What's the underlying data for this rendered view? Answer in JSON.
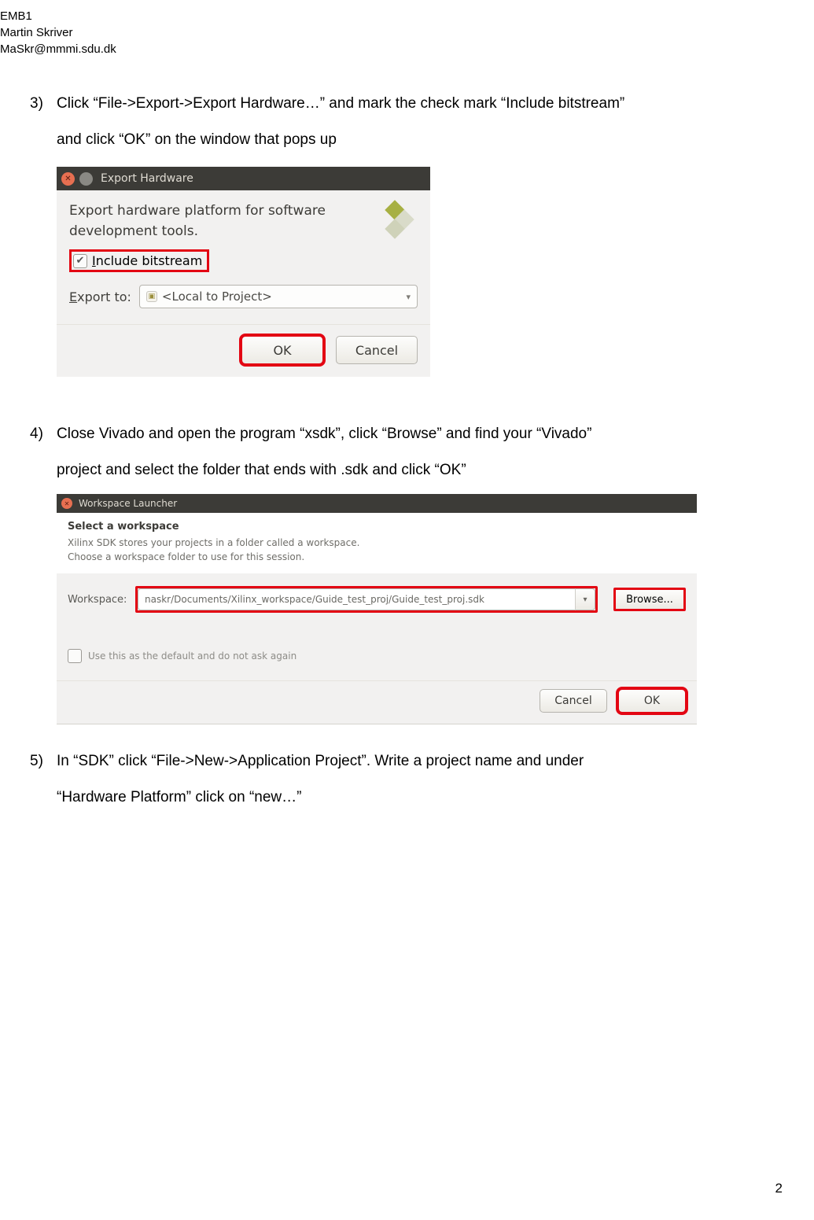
{
  "header": {
    "line1": "EMB1",
    "line2": "Martin Skriver",
    "line3": "MaSkr@mmmi.sdu.dk"
  },
  "steps": {
    "s3": {
      "num": "3)",
      "text_a": "Click “File->Export->Export Hardware…” and mark the check mark “Include bitstream”",
      "text_b": "and click “OK” on the window that pops up"
    },
    "s4": {
      "num": "4)",
      "text_a": "Close Vivado and open the program “xsdk”, click “Browse” and find your “Vivado”",
      "text_b": "project and select the folder that ends with .sdk and click “OK”"
    },
    "s5": {
      "num": "5)",
      "text_a": "In “SDK” click “File->New->Application Project”. Write a project name and under",
      "text_b": "“Hardware Platform” click on “new…”"
    }
  },
  "dlg1": {
    "title": "Export Hardware",
    "desc": "Export hardware platform for software development tools.",
    "include_u": "I",
    "include_rest": "nclude bitstream",
    "export_u": "E",
    "export_rest": "xport to:",
    "combo_value": "<Local to Project>",
    "ok": "OK",
    "cancel": "Cancel"
  },
  "dlg2": {
    "title": "Workspace Launcher",
    "header": "Select a workspace",
    "sub1": "Xilinx SDK stores your projects in a folder called a workspace.",
    "sub2": "Choose a workspace folder to use for this session.",
    "ws_label": "Workspace:",
    "ws_value": "naskr/Documents/Xilinx_workspace/Guide_test_proj/Guide_test_proj.sdk",
    "browse": "Browse...",
    "default_chk": "Use this as the default and do not ask again",
    "cancel": "Cancel",
    "ok": "OK"
  },
  "page_number": "2"
}
